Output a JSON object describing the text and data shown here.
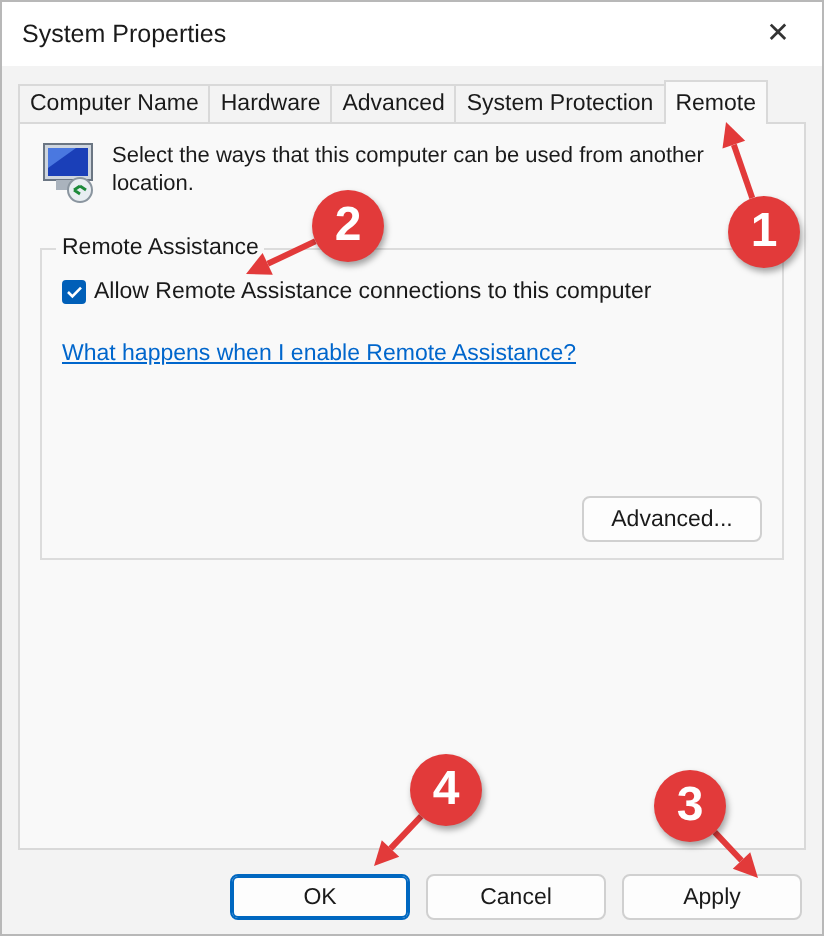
{
  "window": {
    "title": "System Properties",
    "close": "✕"
  },
  "tabs": [
    {
      "label": "Computer Name",
      "selected": false
    },
    {
      "label": "Hardware",
      "selected": false
    },
    {
      "label": "Advanced",
      "selected": false
    },
    {
      "label": "System Protection",
      "selected": false
    },
    {
      "label": "Remote",
      "selected": true
    }
  ],
  "intro": "Select the ways that this computer can be used from another location.",
  "group": {
    "title": "Remote Assistance",
    "checkbox": {
      "label": "Allow Remote Assistance connections to this computer",
      "checked": true
    },
    "link": "What happens when I enable Remote Assistance?",
    "button": "Advanced..."
  },
  "buttons": [
    {
      "label": "OK",
      "kind": "default"
    },
    {
      "label": "Cancel",
      "kind": "normal"
    },
    {
      "label": "Apply",
      "kind": "normal"
    }
  ],
  "annotations": [
    {
      "number": "1"
    },
    {
      "number": "2"
    },
    {
      "number": "3"
    },
    {
      "number": "4"
    }
  ]
}
